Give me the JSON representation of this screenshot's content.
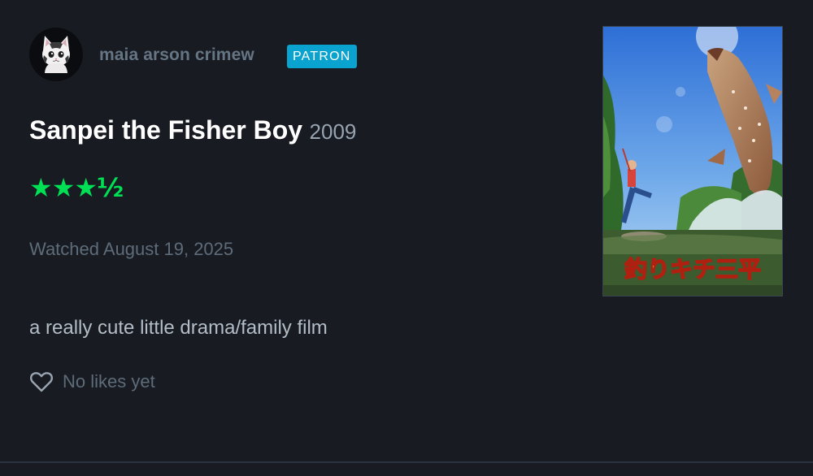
{
  "user": {
    "name": "maia arson crimew",
    "badge": "PATRON",
    "avatar_icon": "cat-avatar-icon"
  },
  "film": {
    "title": "Sanpei the Fisher Boy",
    "year": "2009",
    "poster_title": "釣りキチ三平",
    "poster_icon": "film-poster-image"
  },
  "rating": {
    "stars": 3.5,
    "display": "★★★½"
  },
  "watched": "Watched August 19, 2025",
  "review": "a really cute little drama/family film",
  "likes": {
    "label": "No likes yet",
    "icon": "heart-icon"
  },
  "colors": {
    "background": "#181b22",
    "accent_green": "#00e054",
    "patron_blue": "#0aa3cf"
  }
}
